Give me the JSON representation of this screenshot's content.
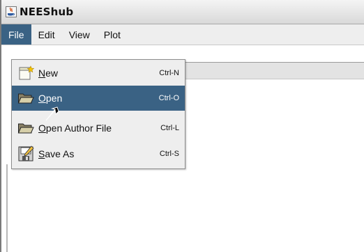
{
  "window": {
    "title": "NEEShub"
  },
  "menubar": {
    "items": [
      {
        "label": "File",
        "active": true
      },
      {
        "label": "Edit",
        "active": false
      },
      {
        "label": "View",
        "active": false
      },
      {
        "label": "Plot",
        "active": false
      }
    ]
  },
  "file_menu": {
    "items": [
      {
        "mnemonic": "N",
        "rest": "ew",
        "shortcut": "Ctrl-N",
        "icon": "new-file-icon",
        "selected": false
      },
      {
        "mnemonic": "O",
        "rest": "pen",
        "shortcut": "Ctrl-O",
        "icon": "open-folder-icon",
        "selected": true
      },
      {
        "mnemonic": "O",
        "rest": "pen Author File",
        "shortcut": "Ctrl-L",
        "icon": "open-folder-icon",
        "selected": false
      },
      {
        "mnemonic": "S",
        "rest": "ave As",
        "shortcut": "Ctrl-S",
        "icon": "save-as-icon",
        "selected": false
      }
    ]
  },
  "colors": {
    "selection": "#3a6284",
    "menu_bg": "#eeeeee"
  }
}
